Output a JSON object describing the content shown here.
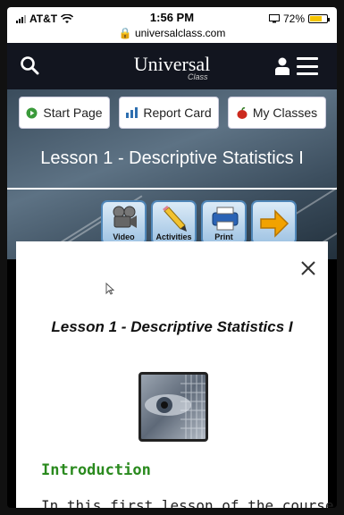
{
  "status_bar": {
    "carrier": "AT&T",
    "time": "1:56 PM",
    "url": "universalclass.com",
    "battery_percent_label": "72%",
    "battery_level": 0.72
  },
  "nav": {
    "brand": "Universal",
    "brand_sub": "Class",
    "icons": [
      "search-icon",
      "user-icon",
      "hamburger-menu-icon"
    ]
  },
  "hero": {
    "buttons": [
      {
        "label": "Start Page",
        "icon": "play-circle-icon",
        "color": "#3a9a3a"
      },
      {
        "label": "Report Card",
        "icon": "bar-chart-icon",
        "color": "#2e6fb0"
      },
      {
        "label": "My Classes",
        "icon": "apple-icon",
        "color": "#cc2a1e"
      }
    ],
    "lesson_title": "Lesson 1 - Descriptive Statistics I",
    "tiles": [
      {
        "label": "Video",
        "icon": "film-camera-icon"
      },
      {
        "label": "Activities",
        "icon": "pencil-icon"
      },
      {
        "label": "Print",
        "icon": "printer-icon"
      },
      {
        "label": "",
        "icon": "arrow-right-icon"
      }
    ]
  },
  "card": {
    "title": "Lesson 1 - Descriptive Statistics I",
    "section_heading": "Introduction",
    "body": "In this first lesson of the course, we"
  },
  "colors": {
    "nav_bg": "#12151f",
    "heading_green": "#2a8a1e",
    "accent_orange": "#f2a200"
  }
}
